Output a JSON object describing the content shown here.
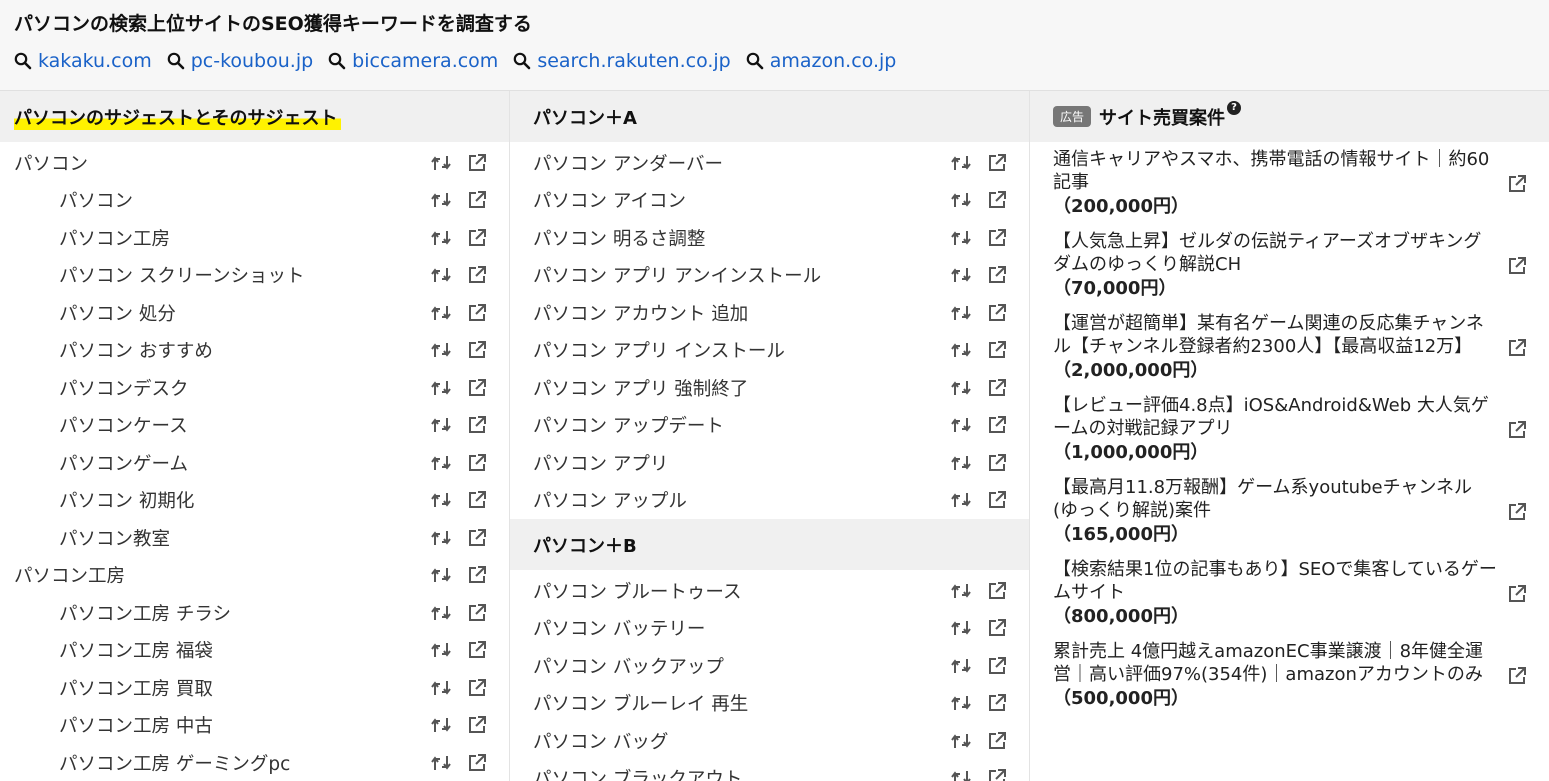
{
  "header": {
    "title": "パソコンの検索上位サイトのSEO獲得キーワードを調査する",
    "sites": [
      "kakaku.com",
      "pc-koubou.jp",
      "biccamera.com",
      "search.rakuten.co.jp",
      "amazon.co.jp"
    ]
  },
  "col1": {
    "heading": "パソコンのサジェストとそのサジェスト",
    "rows": [
      {
        "text": "パソコン",
        "child": false
      },
      {
        "text": "パソコン",
        "child": true
      },
      {
        "text": "パソコン工房",
        "child": true
      },
      {
        "text": "パソコン スクリーンショット",
        "child": true
      },
      {
        "text": "パソコン 処分",
        "child": true
      },
      {
        "text": "パソコン おすすめ",
        "child": true
      },
      {
        "text": "パソコンデスク",
        "child": true
      },
      {
        "text": "パソコンケース",
        "child": true
      },
      {
        "text": "パソコンゲーム",
        "child": true
      },
      {
        "text": "パソコン 初期化",
        "child": true
      },
      {
        "text": "パソコン教室",
        "child": true
      },
      {
        "text": "パソコン工房",
        "child": false
      },
      {
        "text": "パソコン工房 チラシ",
        "child": true
      },
      {
        "text": "パソコン工房 福袋",
        "child": true
      },
      {
        "text": "パソコン工房 買取",
        "child": true
      },
      {
        "text": "パソコン工房 中古",
        "child": true
      },
      {
        "text": "パソコン工房 ゲーミングpc",
        "child": true
      }
    ]
  },
  "col2": {
    "sections": [
      {
        "heading": "パソコン＋A",
        "rows": [
          "パソコン アンダーバー",
          "パソコン アイコン",
          "パソコン 明るさ調整",
          "パソコン アプリ アンインストール",
          "パソコン アカウント 追加",
          "パソコン アプリ インストール",
          "パソコン アプリ 強制終了",
          "パソコン アップデート",
          "パソコン アプリ",
          "パソコン アップル"
        ]
      },
      {
        "heading": "パソコン＋B",
        "rows": [
          "パソコン ブルートゥース",
          "パソコン バッテリー",
          "パソコン バックアップ",
          "パソコン ブルーレイ 再生",
          "パソコン バッグ",
          "パソコン ブラックアウト"
        ]
      }
    ]
  },
  "col3": {
    "badge": "広告",
    "heading": "サイト売買案件",
    "help": "?",
    "ads": [
      {
        "title": "通信キャリアやスマホ、携帯電話の情報サイト｜約60記事",
        "price": "（200,000円）"
      },
      {
        "title": "【人気急上昇】ゼルダの伝説ティアーズオブザキングダムのゆっくり解説CH",
        "price": "（70,000円）"
      },
      {
        "title": "【運営が超簡単】某有名ゲーム関連の反応集チャンネル【チャンネル登録者約2300人】【最高収益12万】",
        "price": "（2,000,000円）"
      },
      {
        "title": "【レビュー評価4.8点】iOS&Android&Web 大人気ゲームの対戦記録アプリ",
        "price": "（1,000,000円）"
      },
      {
        "title": "【最高月11.8万報酬】ゲーム系youtubeチャンネル(ゆっくり解説)案件",
        "price": "（165,000円）"
      },
      {
        "title": "【検索結果1位の記事もあり】SEOで集客しているゲームサイト",
        "price": "（800,000円）"
      },
      {
        "title": "累計売上 4億円越えamazonEC事業譲渡｜8年健全運営｜高い評価97%(354件)｜amazonアカウントのみ",
        "price": "（500,000円）"
      }
    ]
  }
}
